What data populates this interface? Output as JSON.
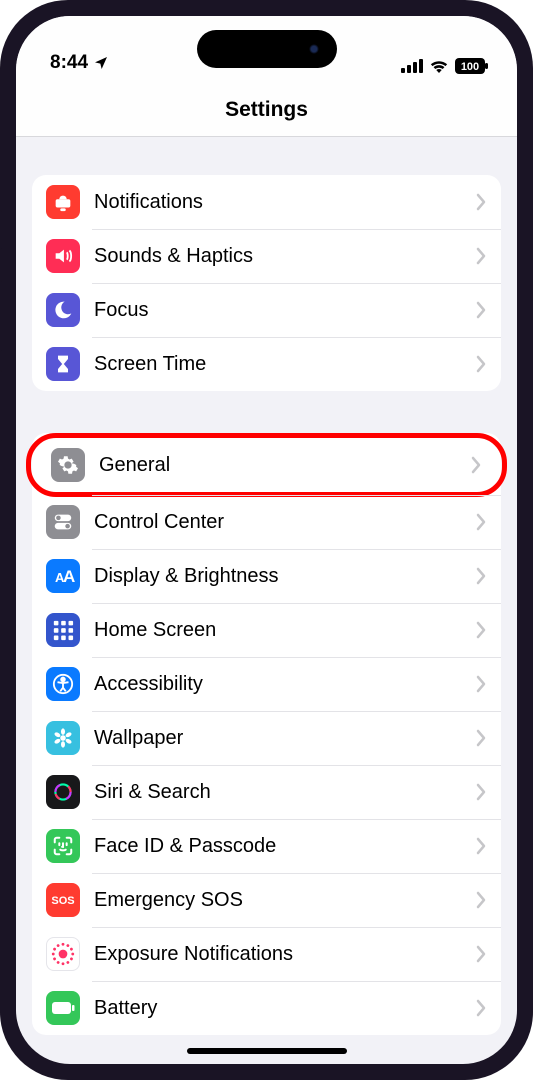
{
  "status": {
    "time": "8:44",
    "battery": "100"
  },
  "header": {
    "title": "Settings"
  },
  "groups": [
    {
      "items": [
        {
          "id": "notifications",
          "label": "Notifications",
          "icon": "bell-icon",
          "bg": "#ff3b30"
        },
        {
          "id": "sounds",
          "label": "Sounds & Haptics",
          "icon": "speaker-icon",
          "bg": "#ff2d55"
        },
        {
          "id": "focus",
          "label": "Focus",
          "icon": "moon-icon",
          "bg": "#5856d6"
        },
        {
          "id": "screentime",
          "label": "Screen Time",
          "icon": "hourglass-icon",
          "bg": "#5856d6"
        }
      ]
    },
    {
      "items": [
        {
          "id": "general",
          "label": "General",
          "icon": "gear-icon",
          "bg": "#8e8e93",
          "highlight": true
        },
        {
          "id": "controlcenter",
          "label": "Control Center",
          "icon": "switches-icon",
          "bg": "#8e8e93"
        },
        {
          "id": "display",
          "label": "Display & Brightness",
          "icon": "aa-icon",
          "bg": "#0a7aff"
        },
        {
          "id": "homescreen",
          "label": "Home Screen",
          "icon": "grid-icon",
          "bg": "#3355cc"
        },
        {
          "id": "accessibility",
          "label": "Accessibility",
          "icon": "accessibility-icon",
          "bg": "#0a7aff"
        },
        {
          "id": "wallpaper",
          "label": "Wallpaper",
          "icon": "flower-icon",
          "bg": "#37c0e0"
        },
        {
          "id": "siri",
          "label": "Siri & Search",
          "icon": "siri-icon",
          "bg": "#18181a"
        },
        {
          "id": "faceid",
          "label": "Face ID & Passcode",
          "icon": "faceid-icon",
          "bg": "#34c759"
        },
        {
          "id": "sos",
          "label": "Emergency SOS",
          "icon": "sos-icon",
          "bg": "#ff3b30"
        },
        {
          "id": "exposure",
          "label": "Exposure Notifications",
          "icon": "exposure-icon",
          "bg": "#ffffff"
        },
        {
          "id": "battery",
          "label": "Battery",
          "icon": "battery-icon",
          "bg": "#34c759"
        }
      ]
    }
  ]
}
